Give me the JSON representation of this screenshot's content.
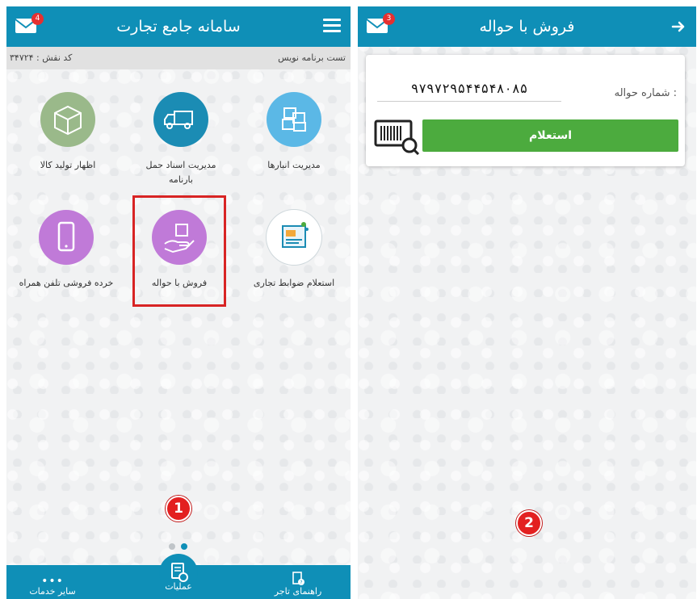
{
  "home": {
    "title": "سامانه جامع تجارت",
    "mail_badge": "4",
    "user_name": "تست برنامه نویس",
    "role_code": "کد نقش : ۳۴۷۲۴",
    "tiles": [
      {
        "label": "مدیریت انبارها",
        "icon": "boxes-icon",
        "color": "#5bb8e6"
      },
      {
        "label": "مدیریت اسناد حمل بارنامه",
        "icon": "truck-icon",
        "color": "#1b8cb4"
      },
      {
        "label": "اظهار تولید کالا",
        "icon": "package-icon",
        "color": "#9ab98a"
      },
      {
        "label": "استعلام ضوابط تجاری",
        "icon": "document-search-icon",
        "color": "#ffffff"
      },
      {
        "label": "فروش با حواله",
        "icon": "hand-box-icon",
        "color": "#c07ad8"
      },
      {
        "label": "خرده فروشی تلفن همراه",
        "icon": "mobile-phone-icon",
        "color": "#c07ad8"
      }
    ],
    "step_badge": "1",
    "bottom_nav": {
      "other_services": "سایر خدمات",
      "operations": "عملیات",
      "merchant_guide": "راهنمای تاجر"
    }
  },
  "sale": {
    "title": "فروش با حواله",
    "mail_badge": "3",
    "field_label": "شماره حواله :",
    "field_value": "۹۷۹۷۲۹۵۴۴۵۴۸۰۸۵",
    "inquire_label": "استعلام",
    "step_badge": "2"
  },
  "colors": {
    "header": "#0f8fb7",
    "accent_green": "#4cab3e",
    "highlight_red": "#d82424"
  }
}
